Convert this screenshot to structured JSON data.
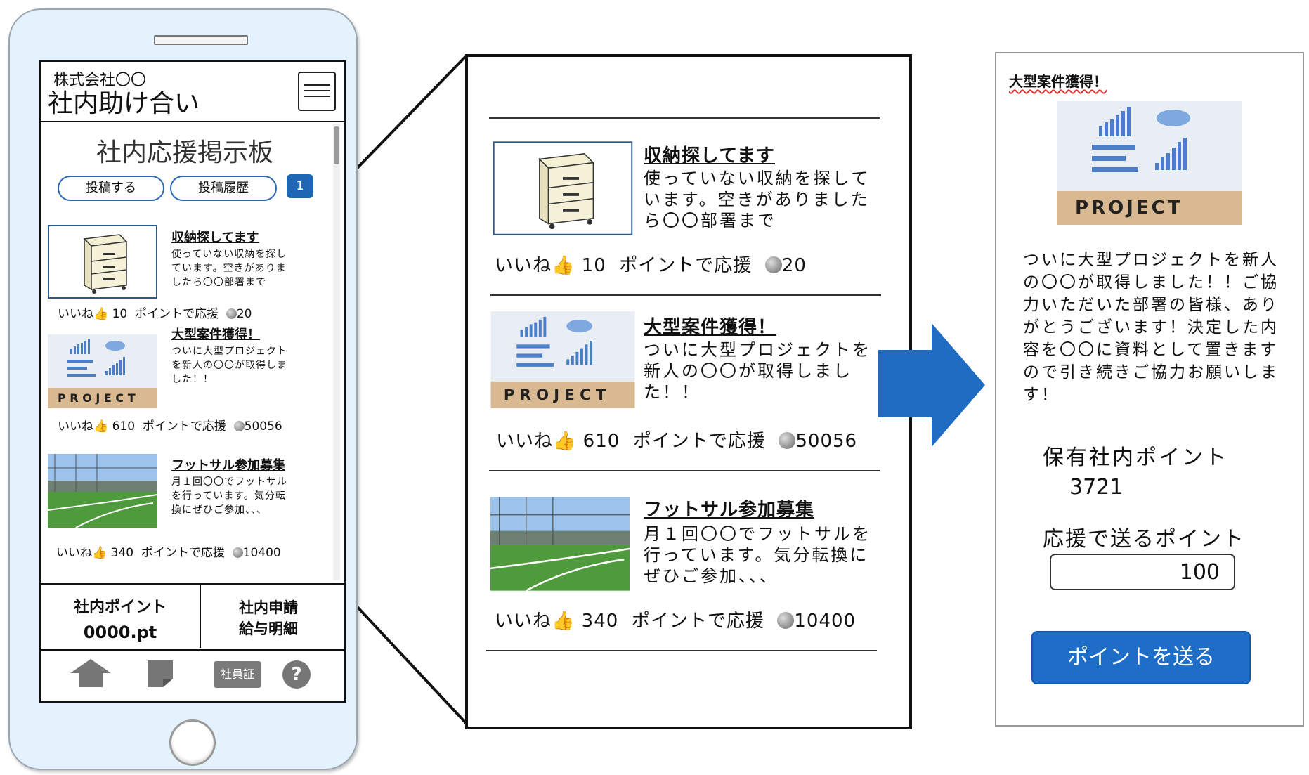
{
  "colors": {
    "accent": "#1e6ec8",
    "phone_bg": "#e3f2fc",
    "badge": "#1f66b5"
  },
  "phone": {
    "company": "株式会社〇〇",
    "app_name": "社内助け合い",
    "board_title": "社内応援掲示板",
    "post_button": "投稿する",
    "history_button": "投稿履歴",
    "notification_count": "1",
    "posts": [
      {
        "title": "収納探してます",
        "desc": "使っていない収納を探しています。空きがありましたら〇〇部署まで",
        "like": "いいね",
        "like_count": "10",
        "support": "ポイントで応援",
        "points": "20",
        "thumb": "cabinet-image"
      },
      {
        "title": "大型案件獲得！",
        "desc": "ついに大型プロジェクトを新人の〇〇が取得しました！！",
        "like": "いいね",
        "like_count": "610",
        "support": "ポイントで応援",
        "points": "50056",
        "thumb": "project-image"
      },
      {
        "title": "フットサル参加募集",
        "desc": "月１回〇〇でフットサルを行っています。気分転換にぜひご参加、、、",
        "like": "いいね",
        "like_count": "340",
        "support": "ポイントで応援",
        "points": "10400",
        "thumb": "futsal-image"
      }
    ],
    "points_label": "社内ポイント",
    "points_value": "0000.pt",
    "apply_line1": "社内申請",
    "apply_line2": "給与明細",
    "id_card": "社員証",
    "help": "?"
  },
  "zoom": {
    "posts": [
      {
        "title": "収納探してます",
        "desc": "使っていない収納を探しています。空きがありましたら〇〇部署まで",
        "like": "いいね",
        "like_count": "10",
        "support": "ポイントで応援",
        "points": "20"
      },
      {
        "title": "大型案件獲得！",
        "desc": "ついに大型プロジェクトを新人の〇〇が取得しました！！",
        "like": "いいね",
        "like_count": "610",
        "support": "ポイントで応援",
        "points": "50056"
      },
      {
        "title": "フットサル参加募集",
        "desc": "月１回〇〇でフットサルを行っています。気分転換にぜひご参加、、、",
        "like": "いいね",
        "like_count": "340",
        "support": "ポイントで応援",
        "points": "10400"
      }
    ]
  },
  "detail": {
    "title": "大型案件獲得！",
    "body": "ついに大型プロジェクトを新人の〇〇が取得しました！！ご協力いただいた部署の皆様、ありがとうございます！決定した内容を〇〇に資料として置きますので引き続きご協力お願いします！",
    "held_points_label": "保有社内ポイント",
    "held_points_value": "3721",
    "send_points_label": "応援で送るポイント",
    "send_points_value": "100",
    "send_button": "ポイントを送る",
    "project_word": "PROJECT"
  }
}
